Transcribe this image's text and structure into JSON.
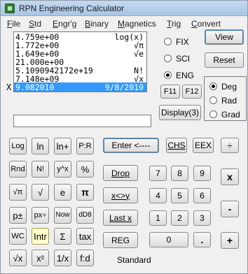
{
  "window": {
    "title": "RPN Engineering Calculator"
  },
  "menu": [
    {
      "label": "File",
      "ul": "F",
      "rest": "ile"
    },
    {
      "label": "Std",
      "ul": "S",
      "rest": "td"
    },
    {
      "label": "Engr'g",
      "ul": "E",
      "rest": "ngr'g"
    },
    {
      "label": "Binary",
      "ul": "B",
      "rest": "inary"
    },
    {
      "label": "Magnetics",
      "ul": "M",
      "rest": "agnetics"
    },
    {
      "label": "Trig",
      "ul": "T",
      "rest": "rig"
    },
    {
      "label": "Convert",
      "ul": "C",
      "rest": "onvert"
    }
  ],
  "stack": [
    {
      "value": "4.759e+00",
      "label": "log(x)"
    },
    {
      "value": "1.772e+00",
      "label": "√π"
    },
    {
      "value": "1.649e+00",
      "label": "√e"
    },
    {
      "value": "21.000e+00",
      "label": ""
    },
    {
      "value": "5.1090942172e+19",
      "label": "N!"
    },
    {
      "value": "7.148e+09",
      "label": "√x"
    },
    {
      "value": "9.082010",
      "label": "9/8/2010"
    }
  ],
  "stack_x_label": "X",
  "format_modes": [
    {
      "label": "FIX",
      "selected": false
    },
    {
      "label": "SCI",
      "selected": false
    },
    {
      "label": "ENG",
      "selected": true
    }
  ],
  "angle_modes": [
    {
      "label": "Deg",
      "selected": true
    },
    {
      "label": "Rad",
      "selected": false
    },
    {
      "label": "Grad",
      "selected": false
    }
  ],
  "controls": {
    "view": "View",
    "reset": "Reset",
    "f11": "F11",
    "f12": "F12",
    "display": "Display(3)"
  },
  "input_line": {
    "value": ""
  },
  "left_keys": [
    [
      "Log",
      "ln",
      "ln+",
      "P:R"
    ],
    [
      "Rnd",
      "N!",
      "y^x",
      "%"
    ],
    [
      "√π",
      "√",
      "e",
      "π"
    ],
    [
      "p±",
      "px÷",
      "Now",
      "dD8"
    ],
    [
      "WC",
      "Intr",
      "Σ",
      "tax"
    ],
    [
      "√x",
      "x²",
      "1/x",
      "f:d"
    ]
  ],
  "highlighted_key": "Intr",
  "mid_keys": {
    "enter": "Enter <----",
    "drop": "Drop",
    "swap": "x<>y",
    "lastx": "Last x",
    "reg": "REG"
  },
  "right_keys": {
    "chs": "CHS",
    "eex": "EEX",
    "divide": "÷",
    "multiply": "x",
    "minus": "-",
    "plus": "+",
    "digits": [
      [
        "7",
        "8",
        "9"
      ],
      [
        "4",
        "5",
        "6"
      ],
      [
        "1",
        "2",
        "3"
      ]
    ],
    "zero": "0",
    "dot": "."
  },
  "status": {
    "mode": "Standard"
  }
}
